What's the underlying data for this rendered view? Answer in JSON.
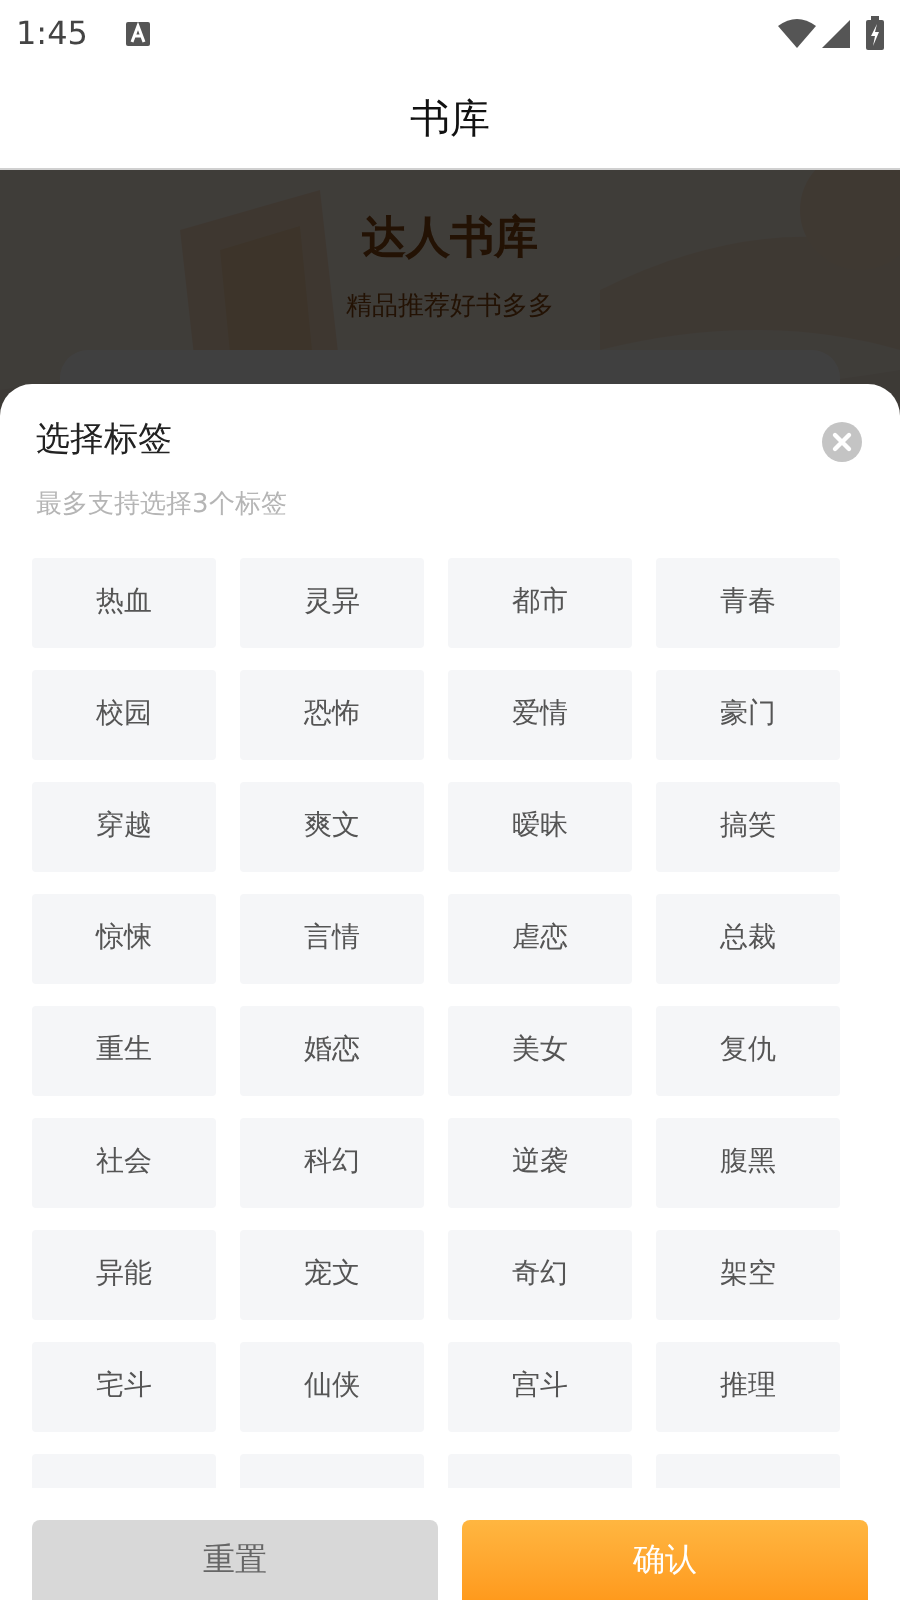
{
  "status_bar": {
    "time": "1:45"
  },
  "header": {
    "title": "书库"
  },
  "banner": {
    "title": "达人书库",
    "subtitle": "精品推荐好书多多"
  },
  "sheet": {
    "title": "选择标签",
    "hint": "最多支持选择3个标签",
    "tags": [
      {
        "label": "热血",
        "selected": false
      },
      {
        "label": "灵异",
        "selected": false
      },
      {
        "label": "都市",
        "selected": false
      },
      {
        "label": "青春",
        "selected": false
      },
      {
        "label": "校园",
        "selected": false
      },
      {
        "label": "恐怖",
        "selected": false
      },
      {
        "label": "爱情",
        "selected": false
      },
      {
        "label": "豪门",
        "selected": false
      },
      {
        "label": "穿越",
        "selected": false
      },
      {
        "label": "爽文",
        "selected": false
      },
      {
        "label": "暧昧",
        "selected": false
      },
      {
        "label": "搞笑",
        "selected": false
      },
      {
        "label": "惊悚",
        "selected": false
      },
      {
        "label": "言情",
        "selected": false
      },
      {
        "label": "虐恋",
        "selected": false
      },
      {
        "label": "总裁",
        "selected": false
      },
      {
        "label": "重生",
        "selected": false
      },
      {
        "label": "婚恋",
        "selected": false
      },
      {
        "label": "美女",
        "selected": false
      },
      {
        "label": "复仇",
        "selected": false
      },
      {
        "label": "社会",
        "selected": false
      },
      {
        "label": "科幻",
        "selected": false
      },
      {
        "label": "逆袭",
        "selected": false
      },
      {
        "label": "腹黑",
        "selected": false
      },
      {
        "label": "异能",
        "selected": false
      },
      {
        "label": "宠文",
        "selected": false
      },
      {
        "label": "奇幻",
        "selected": false
      },
      {
        "label": "架空",
        "selected": false
      },
      {
        "label": "宅斗",
        "selected": false
      },
      {
        "label": "仙侠",
        "selected": false
      },
      {
        "label": "宫斗",
        "selected": false
      },
      {
        "label": "推理",
        "selected": false
      }
    ],
    "buttons": [
      {
        "label": "重置",
        "kind": "secondary"
      },
      {
        "label": "确认",
        "kind": "primary"
      }
    ]
  }
}
